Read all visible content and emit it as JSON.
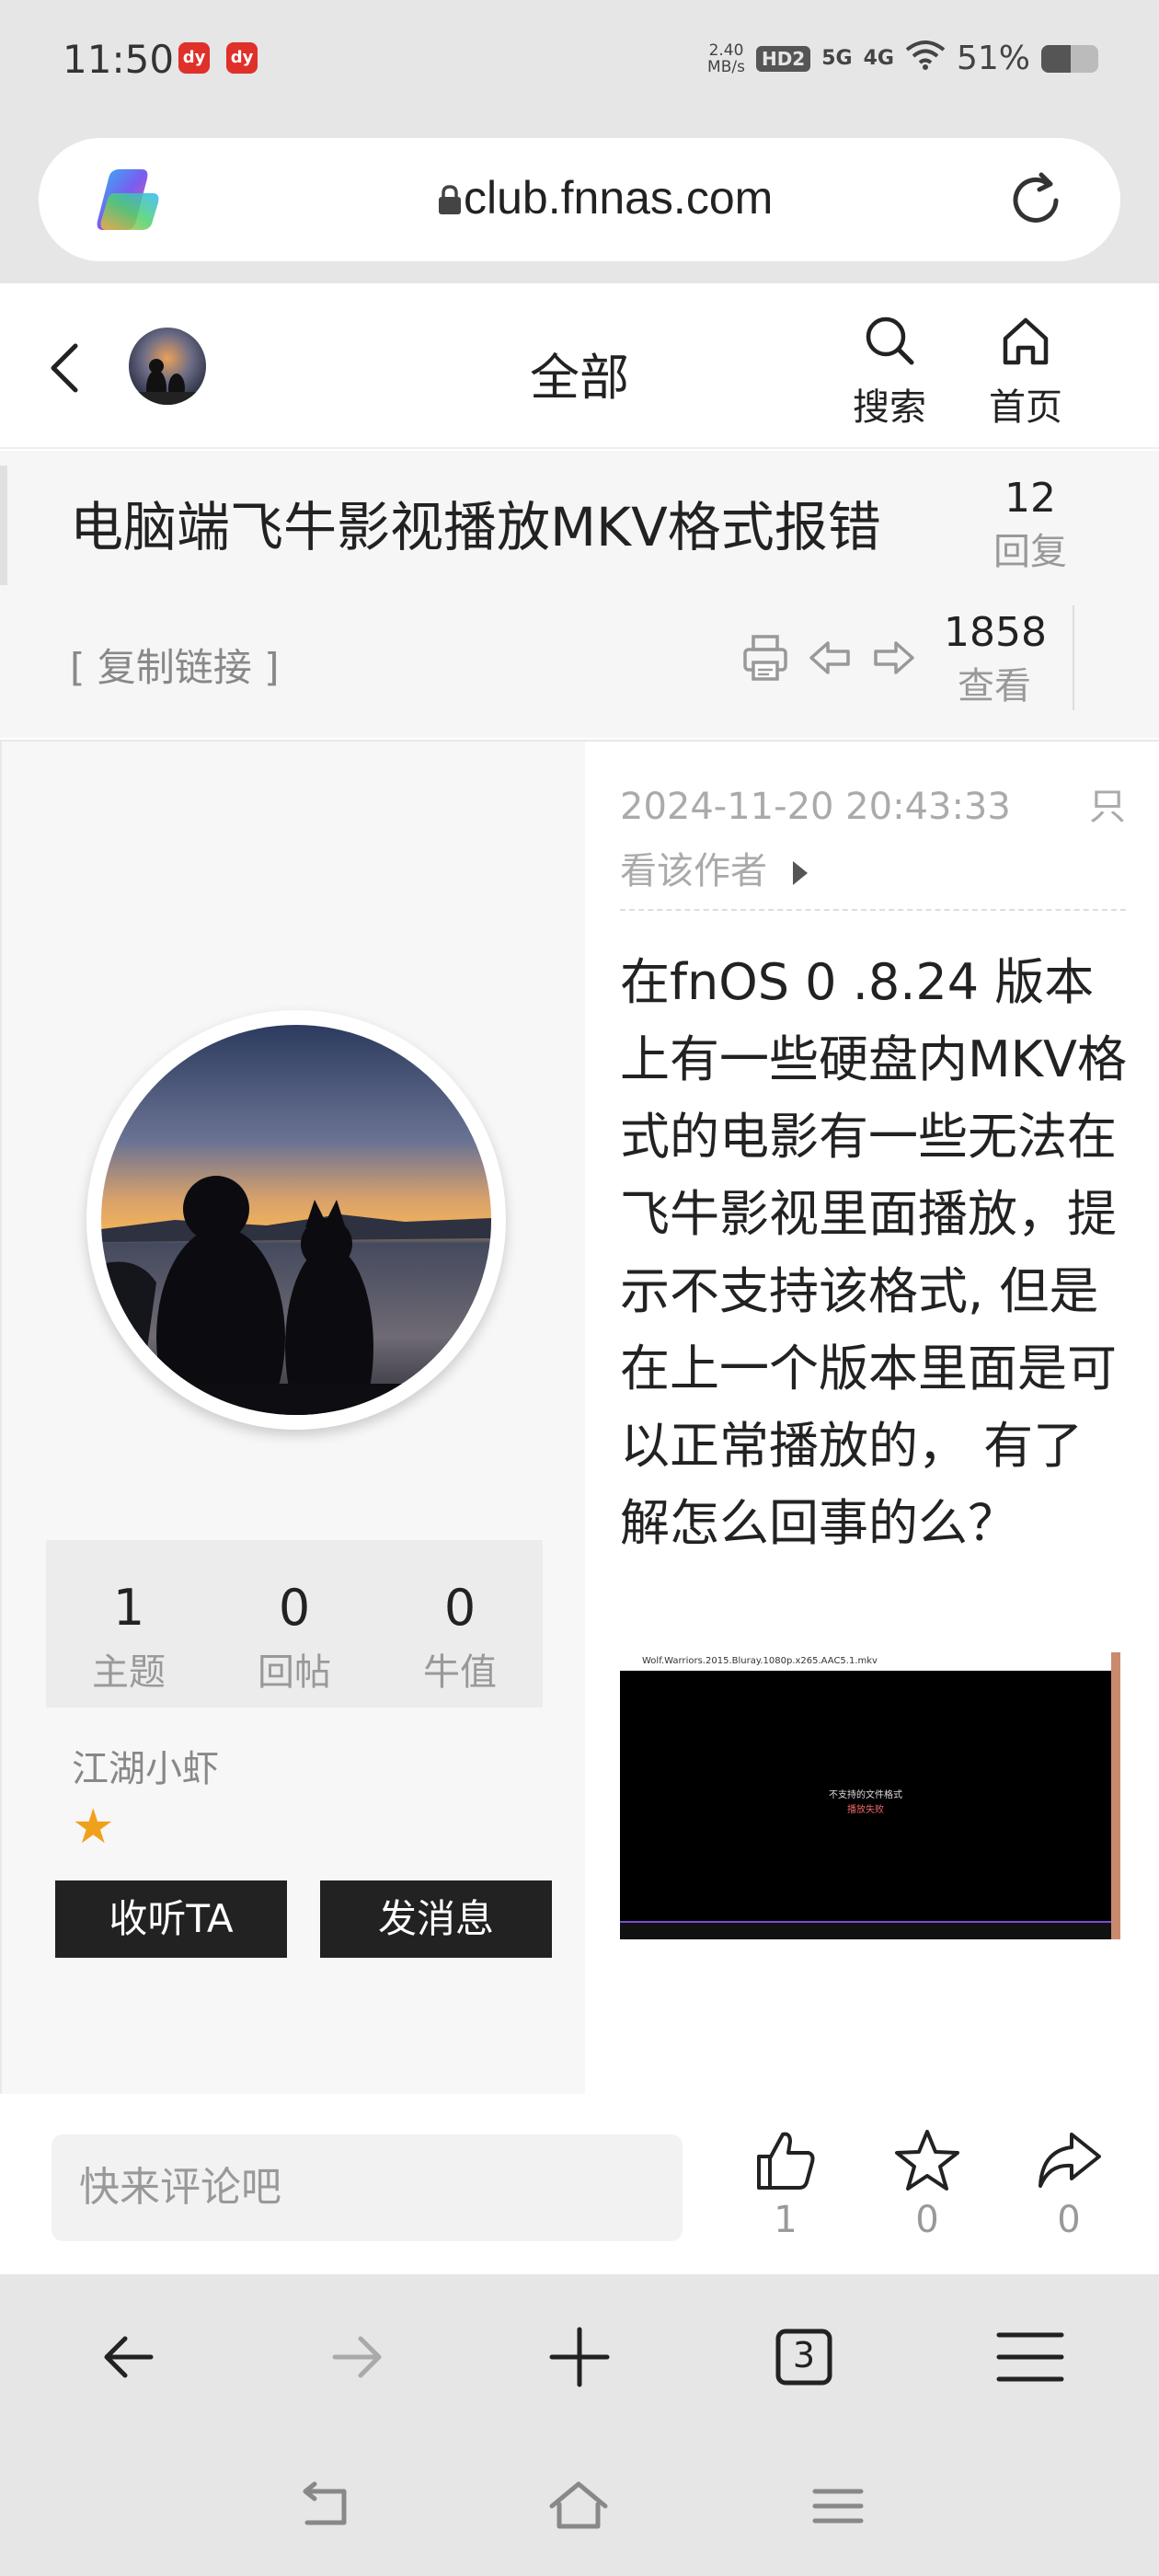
{
  "status_bar": {
    "time": "11:50",
    "app_badge_1": "dy",
    "app_badge_2": "dy",
    "net_speed": "2.40",
    "net_speed_unit": "MB/s",
    "hd": "HD2",
    "net_5g": "5G",
    "net_4g": "4G",
    "battery_text": "51%",
    "battery_level": 0.51
  },
  "browser": {
    "url": "club.fnnas.com"
  },
  "topnav": {
    "title": "全部",
    "search_label": "搜索",
    "home_label": "首页"
  },
  "thread": {
    "title": "电脑端飞牛影视播放MKV格式报错",
    "reply_count": "12",
    "reply_label": "回复",
    "view_count": "1858",
    "view_label": "查看",
    "copy_link": "[ 复制链接 ]"
  },
  "author": {
    "stats": [
      {
        "value": "1",
        "label": "主题"
      },
      {
        "value": "0",
        "label": "回帖"
      },
      {
        "value": "0",
        "label": "牛值"
      }
    ],
    "name": "江湖小虾",
    "star": "★",
    "follow_button": "收听TA",
    "message_button": "发消息"
  },
  "post": {
    "timestamp": "2024-11-20 20:43:33",
    "author_only_part1": "只",
    "author_only_part2": "看该作者",
    "body": "在fnOS 0 .8.24 版本上有一些硬盘内MKV格式的电影有一些无法在飞牛影视里面播放，提示不支持该格式, 但是在上一个版本里面是可以正常播放的， 有了解怎么回事的么？",
    "image_title": "Wolf.Warriors.2015.Bluray.1080p.x265.AAC5.1.mkv",
    "image_error_line1": "不支持的文件格式",
    "image_error_line2": "播放失败"
  },
  "comment_bar": {
    "placeholder": "快来评论吧",
    "like_count": "1",
    "favorite_count": "0",
    "share_count": "0"
  },
  "browser_nav": {
    "tab_count": "3"
  }
}
